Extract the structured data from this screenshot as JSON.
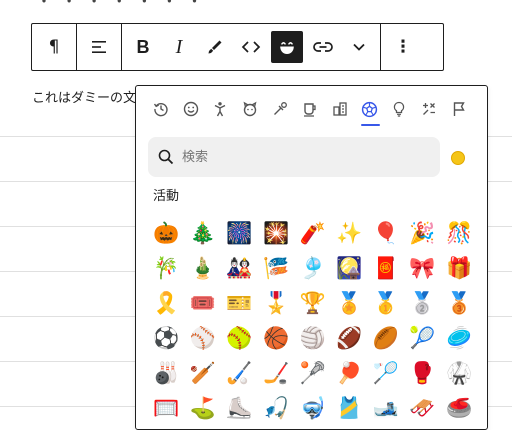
{
  "page": {
    "paragraph_text": "これはダミーの文",
    "top_peek_text": "・ ・ ・ ・ ・ ・ ・ ・"
  },
  "toolbar": {
    "buttons": [
      {
        "name": "paragraph",
        "glyph": "¶"
      },
      {
        "name": "align",
        "glyph": "align"
      },
      {
        "name": "bold",
        "glyph": "B"
      },
      {
        "name": "italic",
        "glyph": "I"
      },
      {
        "name": "highlight",
        "glyph": "brush"
      },
      {
        "name": "code",
        "glyph": "<>"
      },
      {
        "name": "emoji",
        "glyph": "smile",
        "active": true
      },
      {
        "name": "link",
        "glyph": "link"
      },
      {
        "name": "more-rich-text",
        "glyph": "chevron-down"
      },
      {
        "name": "options",
        "glyph": "⋮"
      }
    ]
  },
  "emoji_picker": {
    "categories": [
      {
        "icon": "recent-icon"
      },
      {
        "icon": "smileys-icon"
      },
      {
        "icon": "people-icon"
      },
      {
        "icon": "animals-icon"
      },
      {
        "icon": "food-icon"
      },
      {
        "icon": "drink-icon"
      },
      {
        "icon": "travel-icon"
      },
      {
        "icon": "activities-icon",
        "active": true
      },
      {
        "icon": "objects-icon"
      },
      {
        "icon": "symbols-icon"
      },
      {
        "icon": "flags-icon"
      }
    ],
    "search_placeholder": "検索",
    "search_value": "",
    "skin_tone_color": "#f5c518",
    "accent_color": "#3858e9",
    "section_title": "活動",
    "emojis": [
      "🎃",
      "🎄",
      "🎆",
      "🎇",
      "🧨",
      "✨",
      "🎈",
      "🎉",
      "🎊",
      "🎋",
      "🎍",
      "🎎",
      "🎏",
      "🎐",
      "🎑",
      "🧧",
      "🎀",
      "🎁",
      "🎗️",
      "🎟️",
      "🎫",
      "🎖️",
      "🏆",
      "🏅",
      "🥇",
      "🥈",
      "🥉",
      "⚽",
      "⚾",
      "🥎",
      "🏀",
      "🏐",
      "🏈",
      "🏉",
      "🎾",
      "🥏",
      "🎳",
      "🏏",
      "🏑",
      "🏒",
      "🥍",
      "🏓",
      "🏸",
      "🥊",
      "🥋",
      "🥅",
      "⛳",
      "⛸️",
      "🎣",
      "🤿",
      "🎽",
      "🎿",
      "🛷",
      "🥌"
    ]
  }
}
